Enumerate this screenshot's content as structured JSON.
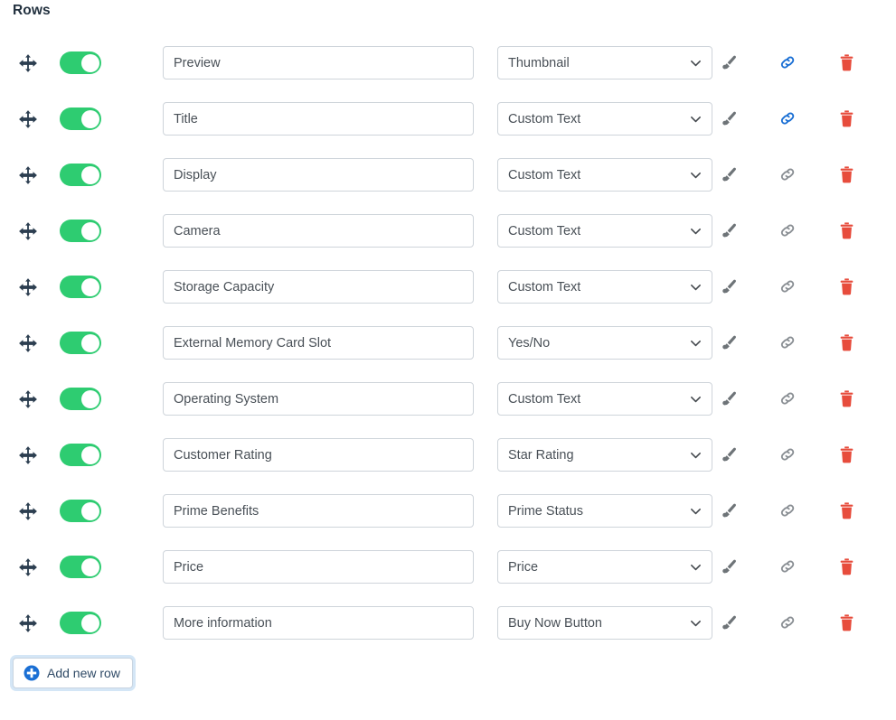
{
  "section": {
    "title": "Rows"
  },
  "colors": {
    "toggle_on": "#2ecc71",
    "link_active": "#1a6fd4",
    "link_inactive": "#8a8f94",
    "trash": "#e74c3c",
    "brush": "#6e7478",
    "drag_handle": "#2c3e50",
    "add_button_accent": "#1a6fd4",
    "input_border": "#ced4da"
  },
  "icons": {
    "drag": "move-arrows-icon",
    "toggle": "toggle-switch-icon",
    "brush": "paintbrush-icon",
    "link": "link-chain-icon",
    "trash": "trash-icon",
    "caret": "chevron-down-icon",
    "plus": "plus-circle-icon"
  },
  "rows": [
    {
      "enabled": true,
      "label": "Preview",
      "type": "Thumbnail",
      "link_active": true
    },
    {
      "enabled": true,
      "label": "Title",
      "type": "Custom Text",
      "link_active": true
    },
    {
      "enabled": true,
      "label": "Display",
      "type": "Custom Text",
      "link_active": false
    },
    {
      "enabled": true,
      "label": "Camera",
      "type": "Custom Text",
      "link_active": false
    },
    {
      "enabled": true,
      "label": "Storage Capacity",
      "type": "Custom Text",
      "link_active": false
    },
    {
      "enabled": true,
      "label": "External Memory Card Slot",
      "type": "Yes/No",
      "link_active": false
    },
    {
      "enabled": true,
      "label": "Operating System",
      "type": "Custom Text",
      "link_active": false
    },
    {
      "enabled": true,
      "label": "Customer Rating",
      "type": "Star Rating",
      "link_active": false
    },
    {
      "enabled": true,
      "label": "Prime Benefits",
      "type": "Prime Status",
      "link_active": false
    },
    {
      "enabled": true,
      "label": "Price",
      "type": "Price",
      "link_active": false
    },
    {
      "enabled": true,
      "label": "More information",
      "type": "Buy Now Button",
      "link_active": false
    }
  ],
  "add_row": {
    "label": "Add new row"
  }
}
